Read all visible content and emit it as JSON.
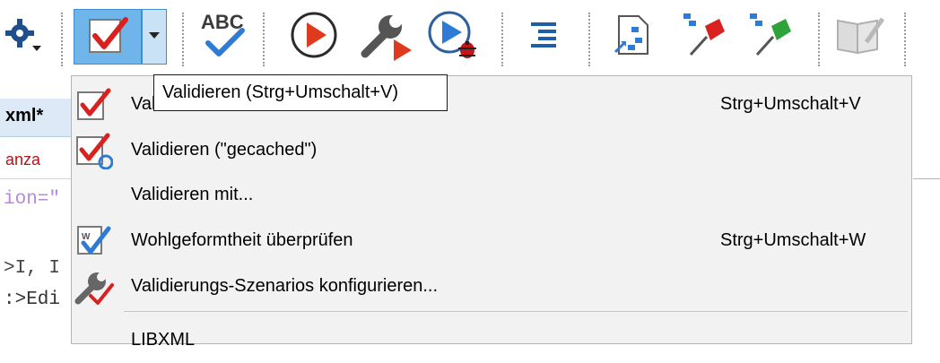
{
  "toolbar": {
    "buttons": [
      {
        "name": "debug-settings",
        "icon": "gear-dropdown-icon"
      },
      {
        "name": "validate",
        "icon": "validate-check-icon",
        "active": true
      },
      {
        "name": "validate-dropdown",
        "icon": "chevron-down-icon"
      },
      {
        "name": "spell-check",
        "icon": "abc-check-icon",
        "text": "ABC"
      },
      {
        "name": "run-transformation",
        "icon": "play-circle-red-icon"
      },
      {
        "name": "configure-transformation",
        "icon": "wrench-play-icon"
      },
      {
        "name": "debug-transformation",
        "icon": "play-circle-bug-icon"
      },
      {
        "name": "format-indent",
        "icon": "format-indent-icon"
      },
      {
        "name": "open-document",
        "icon": "document-tree-icon"
      },
      {
        "name": "pin-red",
        "icon": "pin-red-icon"
      },
      {
        "name": "pin-green",
        "icon": "pin-green-icon"
      },
      {
        "name": "edit-book",
        "icon": "book-edit-icon"
      }
    ]
  },
  "editor": {
    "tab_label": "xml*",
    "breadcrumb": "anza",
    "code_lines": [
      "ion=\"",
      ">I, I",
      ":>Edi"
    ]
  },
  "menu": {
    "items": [
      {
        "label": "Validieren",
        "shortcut": "Strg+Umschalt+V",
        "icon": "validate-check-icon"
      },
      {
        "label": "Validieren (\"gecached\")",
        "shortcut": "",
        "icon": "validate-cached-icon"
      },
      {
        "label": "Validieren mit...",
        "shortcut": "",
        "icon": ""
      },
      {
        "label": "Wohlgeformtheit überprüfen",
        "shortcut": "Strg+Umschalt+W",
        "icon": "wellformed-check-icon"
      },
      {
        "label": "Validierungs-Szenarios konfigurieren...",
        "shortcut": "",
        "icon": "wrench-check-icon"
      },
      {
        "label": "LIBXML",
        "shortcut": "",
        "icon": ""
      }
    ]
  },
  "tooltip": {
    "text": "Validieren (Strg+Umschalt+V)"
  },
  "colors": {
    "accent_blue": "#2e7bd6",
    "check_red": "#d9211f",
    "menu_bg": "#f2f2f2",
    "active_button": "#6fb5ea"
  }
}
